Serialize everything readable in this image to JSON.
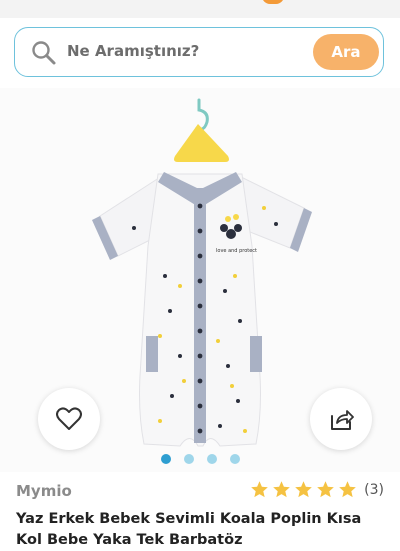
{
  "search": {
    "placeholder": "Ne Aramıştınız?",
    "button_label": "Ara"
  },
  "gallery": {
    "image_count": 4,
    "active_index": 0
  },
  "shirt_print": "love and protect",
  "product": {
    "brand": "Mymio",
    "rating": {
      "stars": 5,
      "count_label": "(3)"
    },
    "title": "Yaz Erkek Bebek Sevimli Koala Poplin Kısa Kol Bebe Yaka Tek Barbatöz"
  },
  "colors": {
    "accent_orange": "#f7b26a",
    "search_border": "#6ec2dc",
    "dot_active": "#2e9ed1",
    "dot_inactive": "#9fd6ea",
    "star": "#f5c242"
  },
  "icons": {
    "search": "magnifier-icon",
    "favorite": "heart-icon",
    "share": "share-icon",
    "rating": "star-icon"
  }
}
